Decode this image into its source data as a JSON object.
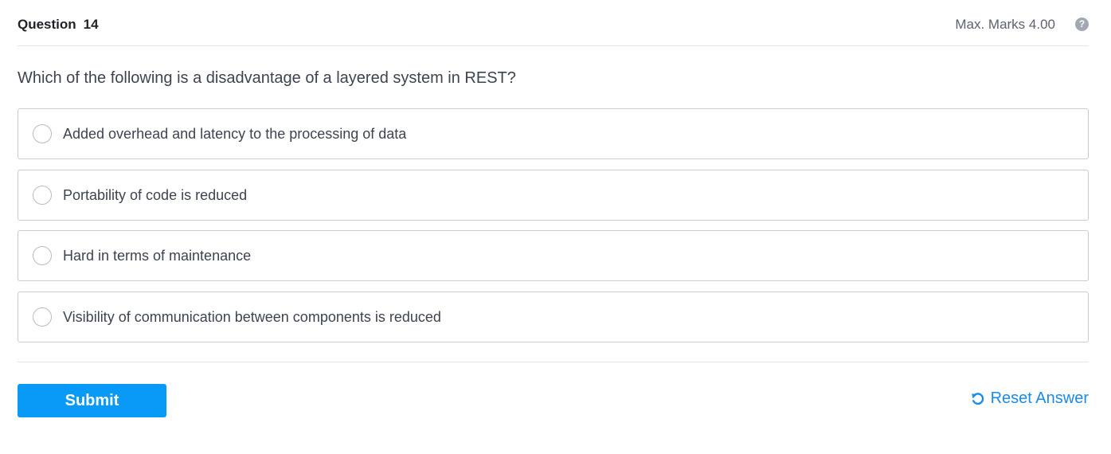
{
  "header": {
    "question_label": "Question",
    "question_number": "14",
    "max_marks": "Max. Marks 4.00",
    "help_icon": "question-circle-icon"
  },
  "question": {
    "text": "Which of the following is a disadvantage of a layered system in REST?"
  },
  "options": [
    {
      "label": "Added overhead and latency to the processing of data",
      "selected": false
    },
    {
      "label": "Portability of code is reduced",
      "selected": false
    },
    {
      "label": "Hard in terms of maintenance",
      "selected": false
    },
    {
      "label": "Visibility of communication between components is reduced",
      "selected": false
    }
  ],
  "footer": {
    "submit_label": "Submit",
    "reset_label": "Reset Answer",
    "reset_icon": "undo-icon"
  },
  "colors": {
    "primary": "#0999f7",
    "link": "#1a8be6",
    "border": "#c9ccd1",
    "text": "#3d4451"
  }
}
